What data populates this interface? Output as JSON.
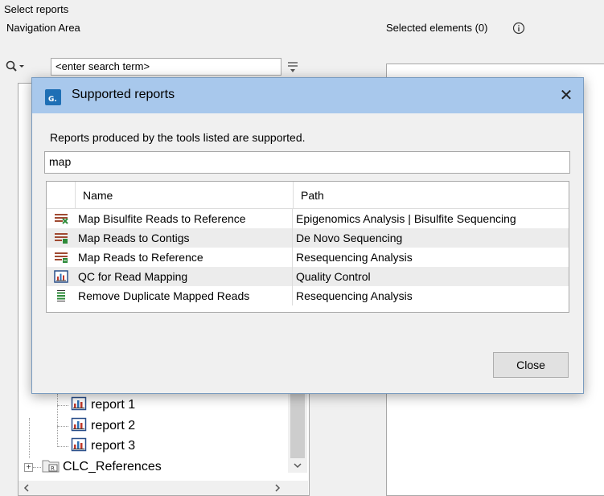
{
  "wizard": {
    "heading": "Select reports",
    "nav_label": "Navigation Area",
    "search_placeholder": "<enter search term>",
    "selected_label": "Selected elements (0)",
    "tree": [
      {
        "label": "report 1",
        "icon": "report-icon"
      },
      {
        "label": "report 2",
        "icon": "report-icon"
      },
      {
        "label": "report 3",
        "icon": "report-icon"
      },
      {
        "label": "CLC_References",
        "icon": "references-folder-icon"
      }
    ]
  },
  "dialog": {
    "title": "Supported reports",
    "description": "Reports produced by the tools listed are supported.",
    "filter_value": "map",
    "columns": {
      "name": "Name",
      "path": "Path"
    },
    "rows": [
      {
        "name": "Map Bisulfite Reads to Reference",
        "path": "Epigenomics Analysis | Bisulfite Sequencing",
        "icon": "map-bisulfite-icon"
      },
      {
        "name": "Map Reads to Contigs",
        "path": "De Novo Sequencing",
        "icon": "map-contigs-icon"
      },
      {
        "name": "Map Reads to Reference",
        "path": "Resequencing Analysis",
        "icon": "map-reference-icon"
      },
      {
        "name": "QC for Read Mapping",
        "path": "Quality Control",
        "icon": "qc-report-icon"
      },
      {
        "name": "Remove Duplicate Mapped Reads",
        "path": "Resequencing Analysis",
        "icon": "remove-duplicates-icon"
      }
    ],
    "close_label": "Close"
  },
  "colors": {
    "titlebar": "#a8c8ec",
    "app_icon": "#1e6fb5"
  }
}
